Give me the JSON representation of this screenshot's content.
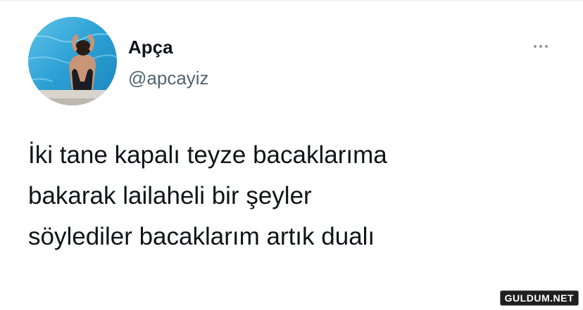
{
  "user": {
    "display_name": "Apça",
    "handle": "@apcayiz",
    "avatar_icon": "profile-photo-pool"
  },
  "more_menu": {
    "icon": "more-horizontal-icon"
  },
  "tweet": {
    "lines": [
      "İki tane kapalı teyze bacaklarıma",
      "bakarak lailaheli bir şeyler",
      "söylediler bacaklarım artık dualı"
    ]
  },
  "watermark": {
    "text": "GULDUM.NET"
  },
  "colors": {
    "text_primary": "#0f1419",
    "text_secondary": "#536471",
    "pool_blue": "#3aa9d8"
  }
}
